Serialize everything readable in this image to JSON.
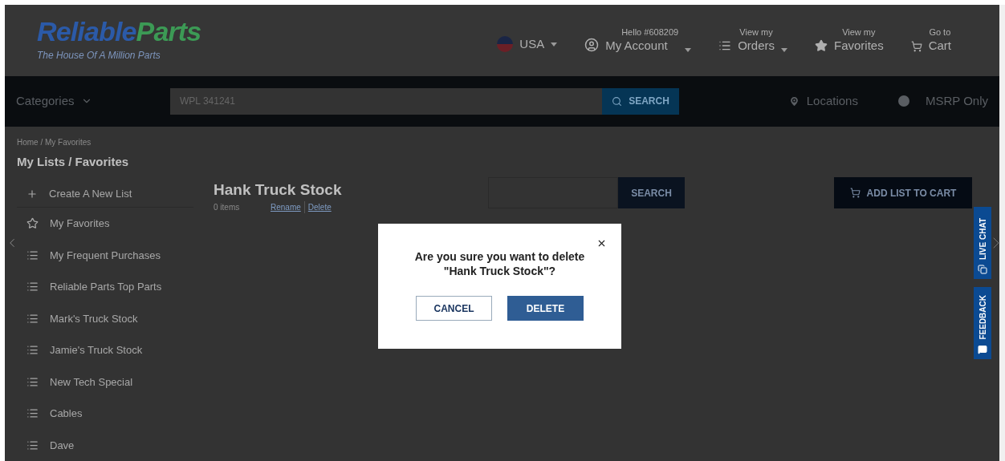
{
  "header": {
    "logo": {
      "word_1": "Reliable",
      "word_2": "Parts",
      "tagline": "The House Of A Million Parts"
    },
    "country": {
      "label": "USA"
    },
    "account": {
      "greeting": "Hello #608209",
      "label": "My Account"
    },
    "orders": {
      "caption": "View my",
      "label": "Orders"
    },
    "favorites": {
      "caption": "View my",
      "label": "Favorites"
    },
    "cart": {
      "caption": "Go to",
      "label": "Cart"
    }
  },
  "nav": {
    "categories": "Categories",
    "search": {
      "value": "WPL 341241",
      "button": "SEARCH"
    },
    "locations": "Locations",
    "msrp_toggle": {
      "label": "MSRP Only",
      "on": false
    }
  },
  "breadcrumb": "Home / My Favorites",
  "page_title": "My Lists / Favorites",
  "sidebar": {
    "create": "Create A New List",
    "items": [
      {
        "label": "My Favorites",
        "kind": "star"
      },
      {
        "label": "My Frequent Purchases",
        "kind": "list"
      },
      {
        "label": "Reliable Parts Top Parts",
        "kind": "list"
      },
      {
        "label": "Mark's Truck Stock",
        "kind": "list"
      },
      {
        "label": "Jamie's Truck Stock",
        "kind": "list"
      },
      {
        "label": "New Tech Special",
        "kind": "list"
      },
      {
        "label": "Cables",
        "kind": "list"
      },
      {
        "label": "Dave",
        "kind": "list"
      }
    ]
  },
  "list": {
    "title": "Hank Truck Stock",
    "count": "0 items",
    "rename": "Rename",
    "delete": "Delete",
    "search_button": "SEARCH",
    "add_to_cart": "ADD LIST TO CART"
  },
  "dialog": {
    "message": "Are you sure you want to delete \"Hank Truck Stock\"?",
    "cancel": "CANCEL",
    "confirm": "DELETE"
  },
  "side_tabs": [
    {
      "label": "LIVE CHAT",
      "kind": "chat"
    },
    {
      "label": "FEEDBACK",
      "kind": "feedback"
    }
  ]
}
